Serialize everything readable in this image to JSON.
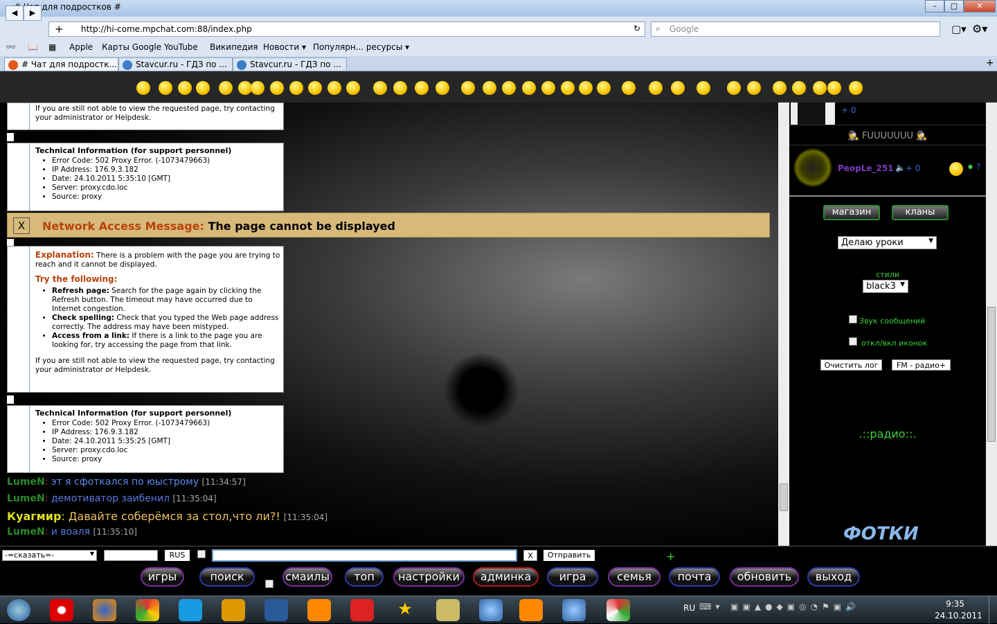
{
  "window": {
    "title": "# Чат для подростков #"
  },
  "browser": {
    "url": "http://hi-come.mpchat.com:88/index.php",
    "search_placeholder": "Google",
    "bookmarks": [
      "Apple",
      "Карты Google",
      "YouTube",
      "Википедия",
      "Новости ▾",
      "Популярн... ресурсы ▾"
    ],
    "tabs": [
      {
        "label": "# Чат для подростк...",
        "active": true
      },
      {
        "label": "Stavcur.ru - ГДЗ по ...",
        "active": false
      },
      {
        "label": "Stavcur.ru - ГДЗ по ...",
        "active": false
      }
    ]
  },
  "error1": {
    "contact": "If you are still not able to view the requested page, try contacting your administrator or Helpdesk."
  },
  "tech1": {
    "title": "Technical Information (for support personnel)",
    "items": [
      "Error Code: 502 Proxy Error. (-1073479663)",
      "IP Address: 176.9.3.182",
      "Date: 24.10.2011 5:35:10 [GMT]",
      "Server: proxy.cdo.loc",
      "Source: proxy"
    ]
  },
  "banner": {
    "close": "X",
    "label": "Network Access Message:",
    "text": "The page cannot be displayed"
  },
  "error2": {
    "expl_label": "Explanation:",
    "expl": "There is a problem with the page you are trying to reach and it cannot be displayed.",
    "try": "Try the following:",
    "items": [
      {
        "b": "Refresh page:",
        "t": "Search for the page again by clicking the Refresh button. The timeout may have occurred due to Internet congestion."
      },
      {
        "b": "Check spelling:",
        "t": "Check that you typed the Web page address correctly. The address may have been mistyped."
      },
      {
        "b": "Access from a link:",
        "t": "If there is a link to the page you are looking for, try accessing the page from that link."
      }
    ],
    "contact": "If you are still not able to view the requested page, try contacting your administrator or Helpdesk."
  },
  "tech2": {
    "title": "Technical Information (for support personnel)",
    "items": [
      "Error Code: 502 Proxy Error. (-1073479663)",
      "IP Address: 176.9.3.182",
      "Date: 24.10.2011 5:35:25 [GMT]",
      "Server: proxy.cdo.loc",
      "Source: proxy"
    ]
  },
  "chat": [
    {
      "nick": "LumeN",
      "sep": ": ",
      "msg": "эт я сфоткался по юыстрому",
      "time": "[11:34:57]"
    },
    {
      "nick": "LumeN",
      "sep": ": ",
      "msg": "демотиватор заибенил",
      "time": "[11:35:04]"
    },
    {
      "nick": "Куагмир",
      "sep": ": ",
      "msg": "Давайте соберёмся за стол,что ли?!",
      "time": "[11:35:04]"
    },
    {
      "nick": "LumeN",
      "sep": ": ",
      "msg": "и воаля",
      "time": "[11:35:10]"
    }
  ],
  "users": {
    "u1_score": "+ 0",
    "group": "FUUUUUUU",
    "u2_nick": "PeopLe_251",
    "u2_score": "+ 0",
    "u2_q": "?"
  },
  "right": {
    "shop": "магазин",
    "clans": "кланы",
    "status": "Делаю уроки",
    "styles_label": "стили",
    "style": "black3",
    "sound": "Звук сообщений",
    "icons": "откл/вкл иконок",
    "clear_log": "Очистить лог",
    "radio_btn": "FM - радио+",
    "radio": ".::радио::.",
    "logo": "ФОТКИ"
  },
  "input": {
    "say": "-=сказать=-",
    "lang": "RUS",
    "clear": "X",
    "send": "Отправить",
    "plus": "+"
  },
  "buttons": [
    {
      "label": "игры",
      "color": "#7a2aa0"
    },
    {
      "label": "поиск",
      "color": "#2a3aa8"
    },
    {
      "label": "смаилы",
      "color": "#7a2aa0"
    },
    {
      "label": "топ",
      "color": "#2a3aa8"
    },
    {
      "label": "настройки",
      "color": "#7a2aa0"
    },
    {
      "label": "админка",
      "color": "#b01818"
    },
    {
      "label": "игра",
      "color": "#2a3aa8"
    },
    {
      "label": "семья",
      "color": "#7a2aa0"
    },
    {
      "label": "почта",
      "color": "#2a3aa8"
    },
    {
      "label": "обновить",
      "color": "#7a2aa0"
    },
    {
      "label": "выход",
      "color": "#2a3aa8"
    }
  ],
  "taskbar": {
    "lang": "RU",
    "time": "9:35",
    "date": "24.10.2011"
  }
}
